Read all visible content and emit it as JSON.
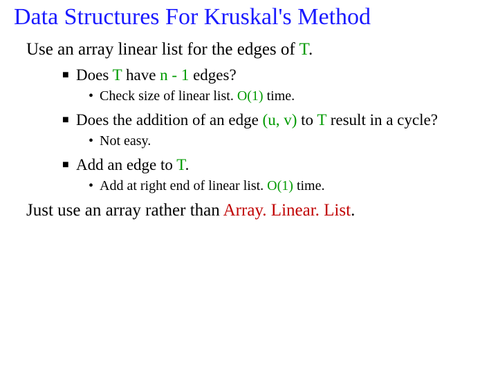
{
  "title": "Data Structures For Kruskal's Method",
  "line1_a": "Use an array linear list for the edges of ",
  "line1_b": "T",
  "line1_c": ".",
  "b1_a": "Does ",
  "b1_b": "T",
  "b1_c": " have ",
  "b1_d": "n - 1",
  "b1_e": " edges?",
  "s1_a": "Check size of linear list. ",
  "s1_b": "O(1)",
  "s1_c": " time.",
  "b2_a": "Does the addition of an edge ",
  "b2_b": "(u, v)",
  "b2_c": " to ",
  "b2_d": "T",
  "b2_e": " result in a cycle?",
  "s2": "Not easy.",
  "b3_a": "Add an edge to ",
  "b3_b": "T",
  "b3_c": ".",
  "s3_a": "Add at right end of linear list. ",
  "s3_b": "O(1)",
  "s3_c": " time.",
  "line2_a": "Just use an array rather than ",
  "line2_b": "Array. Linear. List",
  "line2_c": "."
}
